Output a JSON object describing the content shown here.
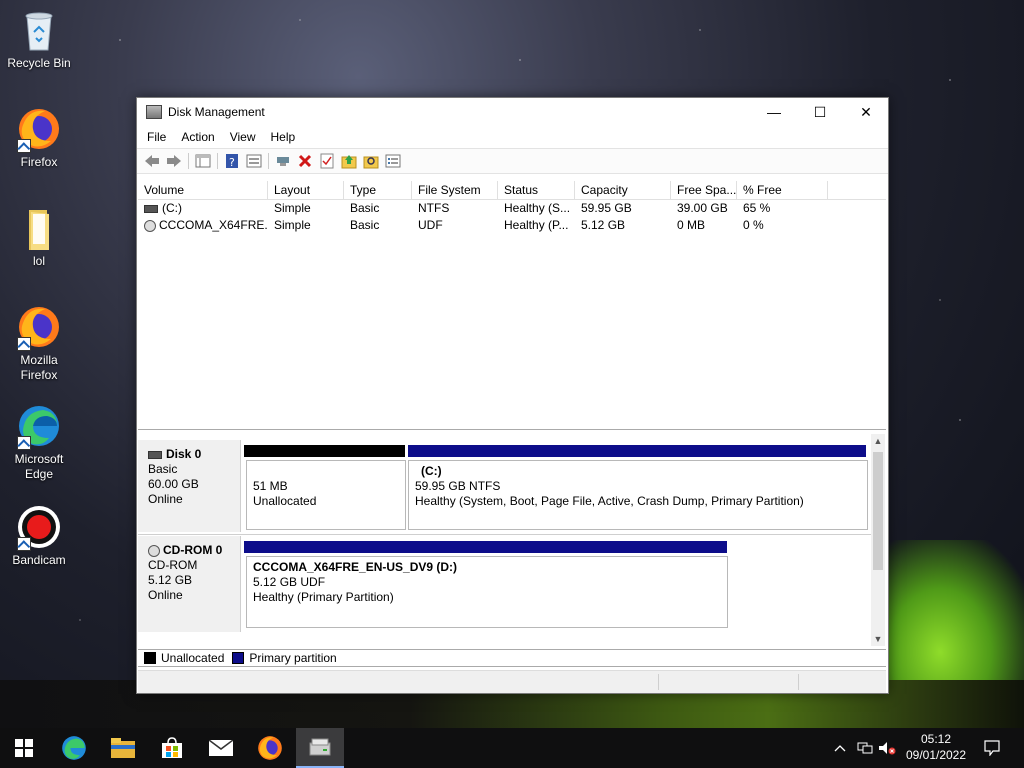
{
  "desktop": {
    "icons": [
      {
        "label": "Recycle Bin",
        "icon": "recycle-bin-icon"
      },
      {
        "label": "Firefox",
        "icon": "firefox-icon"
      },
      {
        "label": "lol",
        "icon": "folder-icon"
      },
      {
        "label": "Mozilla Firefox",
        "icon": "firefox-icon"
      },
      {
        "label": "Microsoft Edge",
        "icon": "edge-icon"
      },
      {
        "label": "Bandicam",
        "icon": "bandicam-icon"
      }
    ]
  },
  "window": {
    "title": "Disk Management",
    "controls": {
      "minimize": "—",
      "maximize": "☐",
      "close": "✕"
    },
    "menu": [
      "File",
      "Action",
      "View",
      "Help"
    ],
    "toolbar_icons": [
      "back-icon",
      "forward-icon",
      "console-tree-icon",
      "help-icon",
      "properties-icon",
      "connect-icon",
      "delete-icon",
      "check-icon",
      "folder-up-icon",
      "find-icon",
      "list-icon"
    ],
    "volume_list": {
      "columns": [
        "Volume",
        "Layout",
        "Type",
        "File System",
        "Status",
        "Capacity",
        "Free Spa...",
        "% Free"
      ],
      "rows": [
        [
          "(C:)",
          "Simple",
          "Basic",
          "NTFS",
          "Healthy (S...",
          "59.95 GB",
          "39.00 GB",
          "65 %"
        ],
        [
          "CCCOMA_X64FRE...",
          "Simple",
          "Basic",
          "UDF",
          "Healthy (P...",
          "5.12 GB",
          "0 MB",
          "0 %"
        ]
      ]
    },
    "disks": [
      {
        "name": "Disk 0",
        "type": "Basic",
        "size": "60.00 GB",
        "state": "Online",
        "partitions": [
          {
            "line1": "",
            "line2": "51 MB",
            "line3": "Unallocated"
          },
          {
            "line1": "(C:)",
            "line2": "59.95 GB NTFS",
            "line3": "Healthy (System, Boot, Page File, Active, Crash Dump, Primary Partition)"
          }
        ]
      },
      {
        "name": "CD-ROM 0",
        "type": "CD-ROM",
        "size": "5.12 GB",
        "state": "Online",
        "partitions": [
          {
            "line1": "CCCOMA_X64FRE_EN-US_DV9  (D:)",
            "line2": "5.12 GB UDF",
            "line3": "Healthy (Primary Partition)"
          }
        ]
      }
    ],
    "legend": {
      "unallocated": "Unallocated",
      "primary": "Primary partition",
      "unallocated_color": "#000000",
      "primary_color": "#0d0d8a"
    }
  },
  "taskbar": {
    "apps": [
      "start-icon",
      "edge-icon",
      "file-explorer-icon",
      "store-icon",
      "mail-icon",
      "firefox-icon",
      "disk-management-icon"
    ],
    "time": "05:12",
    "date": "09/01/2022"
  }
}
